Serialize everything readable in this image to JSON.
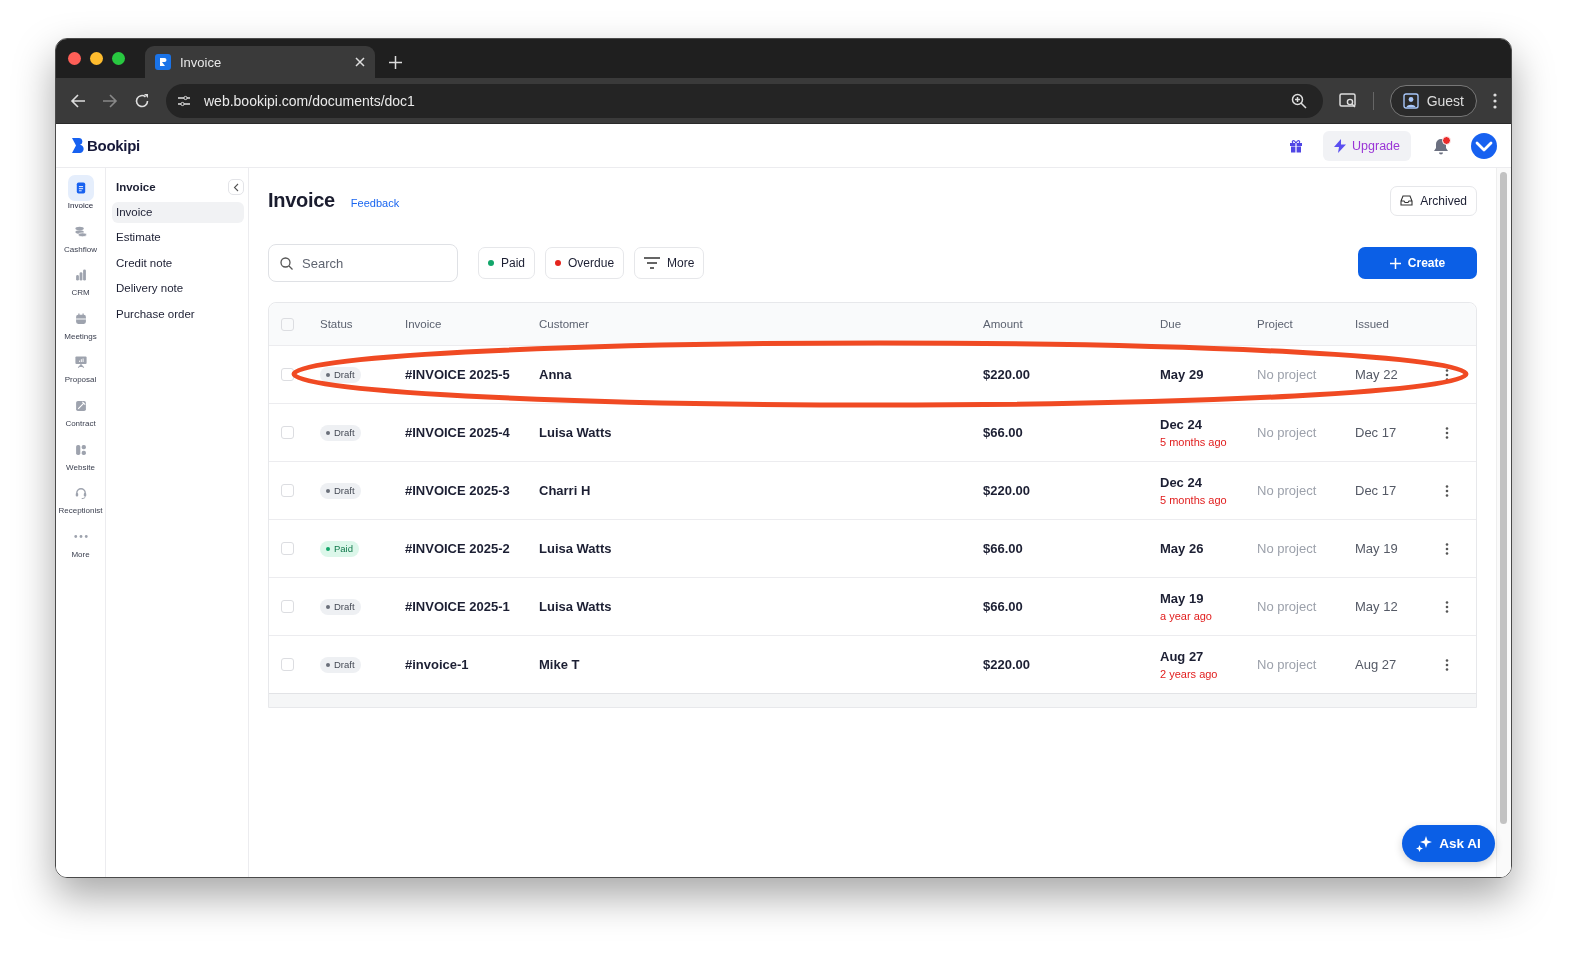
{
  "browser": {
    "tab_title": "Invoice",
    "url": "web.bookipi.com/documents/doc1",
    "profile": "Guest"
  },
  "header": {
    "logo": "Bookipi",
    "upgrade": "Upgrade",
    "unread": true
  },
  "rail": [
    {
      "label": "Invoice",
      "selected": true
    },
    {
      "label": "Cashflow",
      "selected": false
    },
    {
      "label": "CRM",
      "selected": false
    },
    {
      "label": "Meetings",
      "selected": false
    },
    {
      "label": "Proposal",
      "selected": false
    },
    {
      "label": "Contract",
      "selected": false
    },
    {
      "label": "Website",
      "selected": false
    },
    {
      "label": "Receptionist",
      "selected": false
    },
    {
      "label": "More",
      "selected": false
    }
  ],
  "sidebar": {
    "title": "Invoice",
    "items": [
      {
        "label": "Invoice",
        "selected": true
      },
      {
        "label": "Estimate",
        "selected": false
      },
      {
        "label": "Credit note",
        "selected": false
      },
      {
        "label": "Delivery note",
        "selected": false
      },
      {
        "label": "Purchase order",
        "selected": false
      }
    ]
  },
  "page": {
    "title": "Invoice",
    "feedback": "Feedback",
    "archived": "Archived",
    "search": {
      "placeholder": "Search"
    },
    "filters": [
      {
        "kind": "dot",
        "label": "Paid",
        "color": "#12a66a"
      },
      {
        "kind": "dot",
        "label": "Overdue",
        "color": "#e5251d"
      },
      {
        "kind": "menu",
        "label": "More"
      }
    ],
    "create": "Create"
  },
  "table": {
    "select_all": {
      "checked": false
    },
    "columns": [
      "Status",
      "Invoice",
      "Customer",
      "Amount",
      "Due",
      "Project",
      "Issued"
    ],
    "rows": [
      {
        "checked": false,
        "status": {
          "label": "Draft",
          "kind": "draft"
        },
        "invoice": "#INVOICE 2025-5",
        "customer": "Anna",
        "amount": "$220.00",
        "due": "May 29",
        "project": "No project",
        "issued": "May 22"
      },
      {
        "checked": false,
        "status": {
          "label": "Draft",
          "kind": "draft"
        },
        "invoice": "#INVOICE 2025-4",
        "customer": "Luisa Watts",
        "amount": "$66.00",
        "due": "Dec 24",
        "overdue": "5 months ago",
        "project": "No project",
        "issued": "Dec 17"
      },
      {
        "checked": false,
        "status": {
          "label": "Draft",
          "kind": "draft"
        },
        "invoice": "#INVOICE 2025-3",
        "customer": "Charri H",
        "amount": "$220.00",
        "due": "Dec 24",
        "overdue": "5 months ago",
        "project": "No project",
        "issued": "Dec 17"
      },
      {
        "checked": false,
        "status": {
          "label": "Paid",
          "kind": "paid"
        },
        "invoice": "#INVOICE 2025-2",
        "customer": "Luisa Watts",
        "amount": "$66.00",
        "due": "May 26",
        "project": "No project",
        "issued": "May 19"
      },
      {
        "checked": false,
        "status": {
          "label": "Draft",
          "kind": "draft"
        },
        "invoice": "#INVOICE 2025-1",
        "customer": "Luisa Watts",
        "amount": "$66.00",
        "due": "May 19",
        "overdue": "a year ago",
        "project": "No project",
        "issued": "May 12"
      },
      {
        "checked": false,
        "status": {
          "label": "Draft",
          "kind": "draft"
        },
        "invoice": "#invoice-1",
        "customer": "Mike T",
        "amount": "$220.00",
        "due": "Aug 27",
        "overdue": "2 years ago",
        "project": "No project",
        "issued": "Aug 27"
      }
    ]
  },
  "annotation": {
    "kind": "ellipse",
    "color": "#f04a23"
  },
  "ask_ai": "Ask AI"
}
